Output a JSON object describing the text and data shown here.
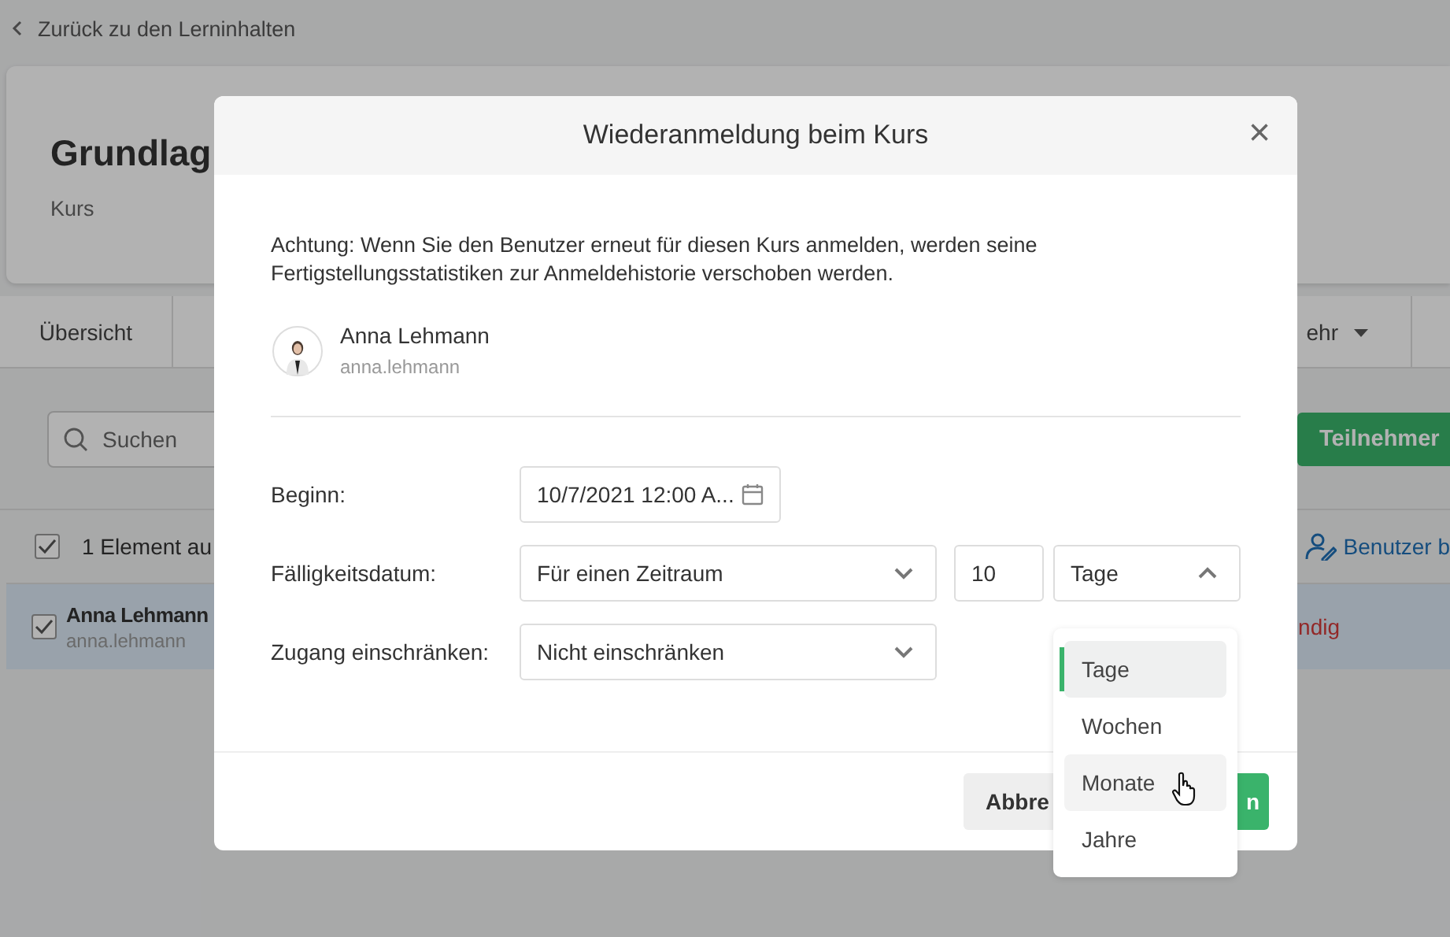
{
  "back_link": {
    "label": "Zurück zu den Lerninhalten"
  },
  "course": {
    "title": "Grundlag",
    "type": "Kurs"
  },
  "tabs": [
    {
      "label": "Übersicht",
      "selected": false
    },
    {
      "label": "ehr",
      "selected": false
    }
  ],
  "search": {
    "placeholder": "Suchen"
  },
  "add_button": {
    "label": "Teilnehmer"
  },
  "selection_bar": {
    "checked": true,
    "label": "1 Element au",
    "action": "Benutzer b"
  },
  "rows": [
    {
      "name": "Anna Lehmann",
      "username": "anna.lehmann",
      "status": "ndig",
      "checked": true,
      "selected": true
    }
  ],
  "dialog": {
    "title": "Wiederanmeldung beim Kurs",
    "close": "×",
    "warning": "Achtung: Wenn Sie den Benutzer erneut für diesen Kurs anmelden, werden seine Fertigstellungsstatistiken zur Anmeldehistorie verschoben werden.",
    "user": {
      "name": "Anna Lehmann",
      "username": "anna.lehmann"
    },
    "fields": [
      {
        "kind": "date",
        "label": "Beginn:",
        "value": "10/7/2021 12:00 A..."
      },
      {
        "kind": "period",
        "label": "Fälligkeitsdatum:",
        "value": "Für einen Zeitraum",
        "amount": "10",
        "unit": "Tage",
        "expanded": true
      },
      {
        "kind": "select",
        "label": "Zugang einschränken:",
        "value": "Nicht einschränken",
        "expanded": false
      }
    ],
    "buttons": [
      {
        "label": "Abbre",
        "kind": "secondary"
      },
      {
        "label": "n",
        "kind": "primary"
      }
    ]
  },
  "unit_options": [
    {
      "label": "Tage",
      "selected": true,
      "hovered": false
    },
    {
      "label": "Wochen",
      "selected": false,
      "hovered": false
    },
    {
      "label": "Monate",
      "selected": false,
      "hovered": true
    },
    {
      "label": "Jahre",
      "selected": false,
      "hovered": false
    }
  ]
}
